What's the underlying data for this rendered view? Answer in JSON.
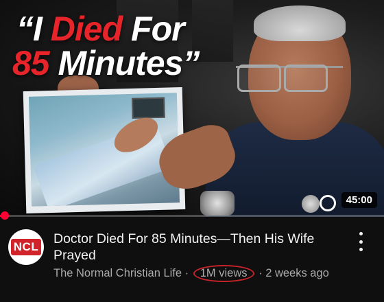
{
  "thumbnail": {
    "headline_line1_prefix": "“I ",
    "headline_line1_highlight": "Died",
    "headline_line1_suffix": " For",
    "headline_line2_highlight": "85",
    "headline_line2_suffix": " Minutes”",
    "duration": "45:00",
    "progress_fraction": 0.012,
    "colors": {
      "headline_highlight": "#e8242b",
      "headline_text": "#ffffff",
      "progress": "#ff0033"
    }
  },
  "video": {
    "title": "Doctor Died For 85 Minutes—Then His Wife Prayed",
    "channel": "The Normal Christian Life",
    "separator": " · ",
    "views": "1M views",
    "age": "2 weeks ago"
  },
  "channel_avatar": {
    "text": "NCL",
    "accent": "#d0232a"
  },
  "icons": {
    "more": "more-vert-icon",
    "autoplay": "autoplay-ring-icon"
  }
}
